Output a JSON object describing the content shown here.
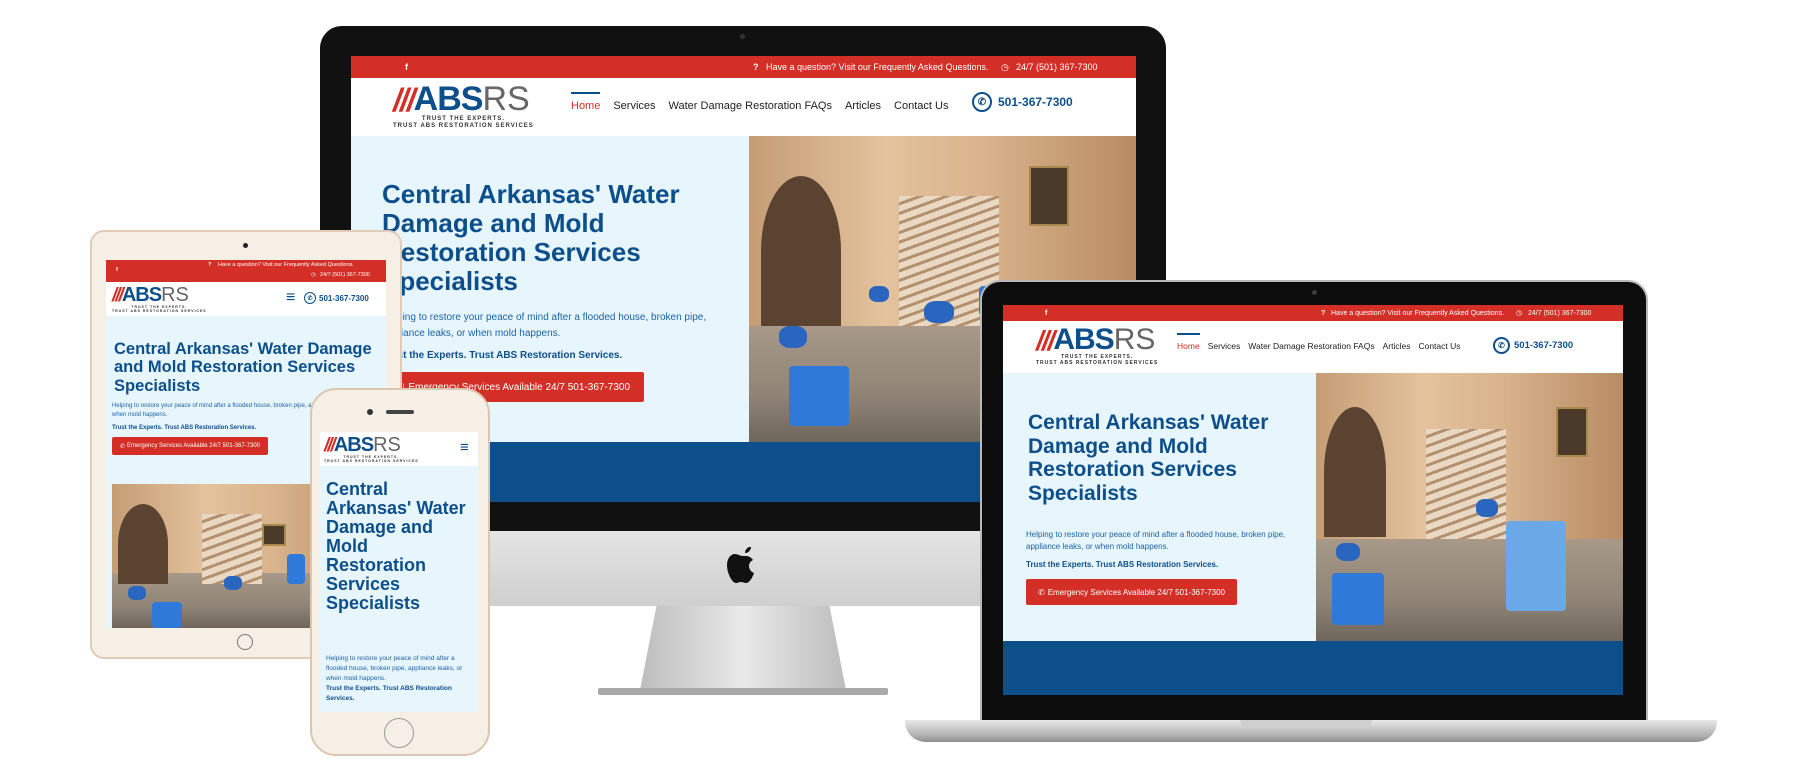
{
  "site": {
    "topbar": {
      "facebook": "f",
      "question_icon": "?",
      "question_text": "Have a question? Visit our Frequently Asked Questions.",
      "clock_icon": "◷",
      "hours_text": "24/7 (501) 367-7300"
    },
    "logo": {
      "slashes": "///",
      "abs": "ABS",
      "rs": "RS",
      "tagline_1": "TRUST THE EXPERTS.",
      "tagline_2": "TRUST ABS RESTORATION SERVICES"
    },
    "nav": [
      "Home",
      "Services",
      "Water Damage Restoration FAQs",
      "Articles",
      "Contact Us"
    ],
    "phone_icon": "✆",
    "phone": "501-367-7300",
    "hero": {
      "title": "Central Arkansas' Water Damage and Mold Restoration Services Specialists",
      "body": "Helping to restore your peace of mind after a flooded house, broken pipe, appliance leaks, or when mold happens.",
      "strong": "Trust the Experts. Trust ABS Restoration Services.",
      "cta_icon": "✆",
      "cta": "Emergency Services Available 24/7 501-367-7300"
    }
  },
  "colors": {
    "red": "#d42f27",
    "navy": "#0d4f8b",
    "hero_bg": "#e7f5fd",
    "green": "#2e9a3e"
  },
  "icons": {
    "apple_logo": "apple-logo-icon",
    "hamburger": "≡"
  }
}
